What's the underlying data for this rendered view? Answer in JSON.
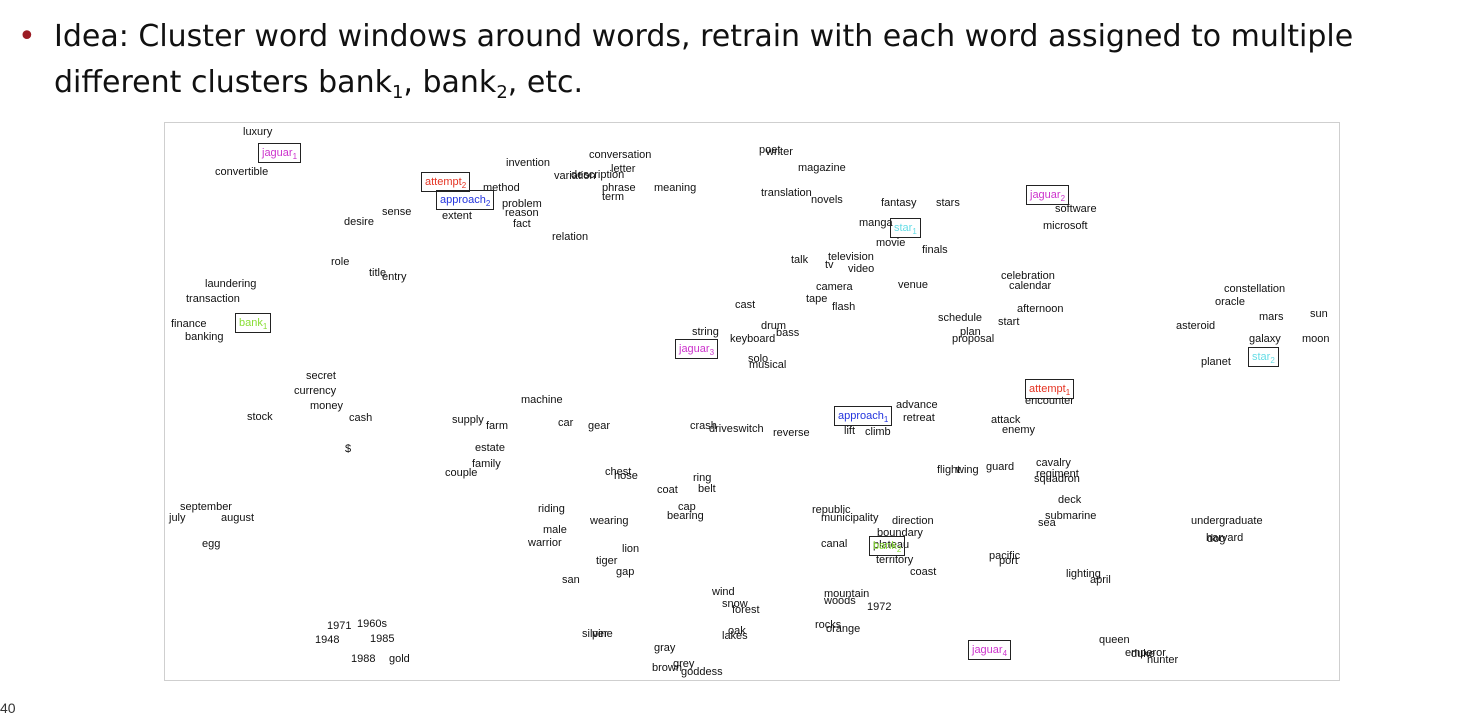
{
  "slide": {
    "bullet_line1": "Idea: Cluster word windows around words, retrain with each word assigned to multiple",
    "bullet_line2_prefix": "different clusters bank",
    "bullet_sub1": "1",
    "bullet_mid": ", bank",
    "bullet_sub2": "2",
    "bullet_suffix": ", etc.",
    "page_number": "40"
  },
  "colors": {
    "bullet": "#9b1c24",
    "jaguar": "#cc33cc",
    "attempt": "#e53322",
    "approach": "#2233dd",
    "star": "#66dde6",
    "bank": "#88dd33"
  },
  "words": [
    "luxury",
    "convertible",
    "invention",
    "conversation",
    "letter",
    "variation",
    "description",
    "writer",
    "poet",
    "magazine",
    "method",
    "problem",
    "reason",
    "fact",
    "extent",
    "phrase",
    "term",
    "meaning",
    "translation",
    "novels",
    "fantasy",
    "stars",
    "software",
    "microsoft",
    "desire",
    "sense",
    "relation",
    "manga",
    "movie",
    "finals",
    "role",
    "title",
    "entry",
    "talk",
    "tv",
    "television",
    "video",
    "celebration",
    "calendar",
    "laundering",
    "transaction",
    "camera",
    "venue",
    "constellation",
    "oracle",
    "cast",
    "tape",
    "flash",
    "afternoon",
    "schedule",
    "start",
    "mars",
    "sun",
    "finance",
    "banking",
    "string",
    "keyboard",
    "drum",
    "bass",
    "plan",
    "proposal",
    "asteroid",
    "galaxy",
    "moon",
    "solo",
    "musical",
    "planet",
    "secret",
    "currency",
    "money",
    "cash",
    "stock",
    "machine",
    "advance",
    "retreat",
    "encounter",
    "supply",
    "farm",
    "car",
    "gear",
    "crash",
    "drive",
    "switch",
    "reverse",
    "lift",
    "climb",
    "attack",
    "enemy",
    "estate",
    "$",
    "family",
    "couple",
    "chest",
    "hose",
    "ring",
    "belt",
    "coat",
    "flight",
    "wing",
    "guard",
    "cavalry",
    "regiment",
    "squadron",
    "deck",
    "september",
    "july",
    "august",
    "riding",
    "wearing",
    "cap",
    "bearing",
    "republic",
    "municipality",
    "direction",
    "boundary",
    "sea",
    "submarine",
    "undergraduate",
    "harvard",
    "dog",
    "male",
    "warrior",
    "lion",
    "tiger",
    "gap",
    "canal",
    "plateau",
    "territory",
    "coast",
    "pacific",
    "port",
    "april",
    "egg",
    "san",
    "lighting",
    "wind",
    "snow",
    "forest",
    "mountain",
    "woods",
    "1972",
    "1971",
    "1960s",
    "1948",
    "1985",
    "1988",
    "gold",
    "silver",
    "pine",
    "oak",
    "lakes",
    "rocks",
    "orange",
    "gray",
    "grey",
    "brown",
    "goddess",
    "queen",
    "emperor",
    "duke",
    "hunter"
  ],
  "boxed_labels": {
    "jaguar1": {
      "word": "jaguar",
      "sub": "1"
    },
    "jaguar2": {
      "word": "jaguar",
      "sub": "2"
    },
    "jaguar3": {
      "word": "jaguar",
      "sub": "3"
    },
    "jaguar4": {
      "word": "jaguar",
      "sub": "4"
    },
    "attempt1": {
      "word": "attempt",
      "sub": "1"
    },
    "attempt2": {
      "word": "attempt",
      "sub": "2"
    },
    "approach1": {
      "word": "approach",
      "sub": "1"
    },
    "approach2": {
      "word": "approach",
      "sub": "2"
    },
    "star1": {
      "word": "star",
      "sub": "1"
    },
    "star2": {
      "word": "star",
      "sub": "2"
    },
    "bank1": {
      "word": "bank",
      "sub": "1"
    },
    "bank2": {
      "word": "bank",
      "sub": "2"
    }
  }
}
